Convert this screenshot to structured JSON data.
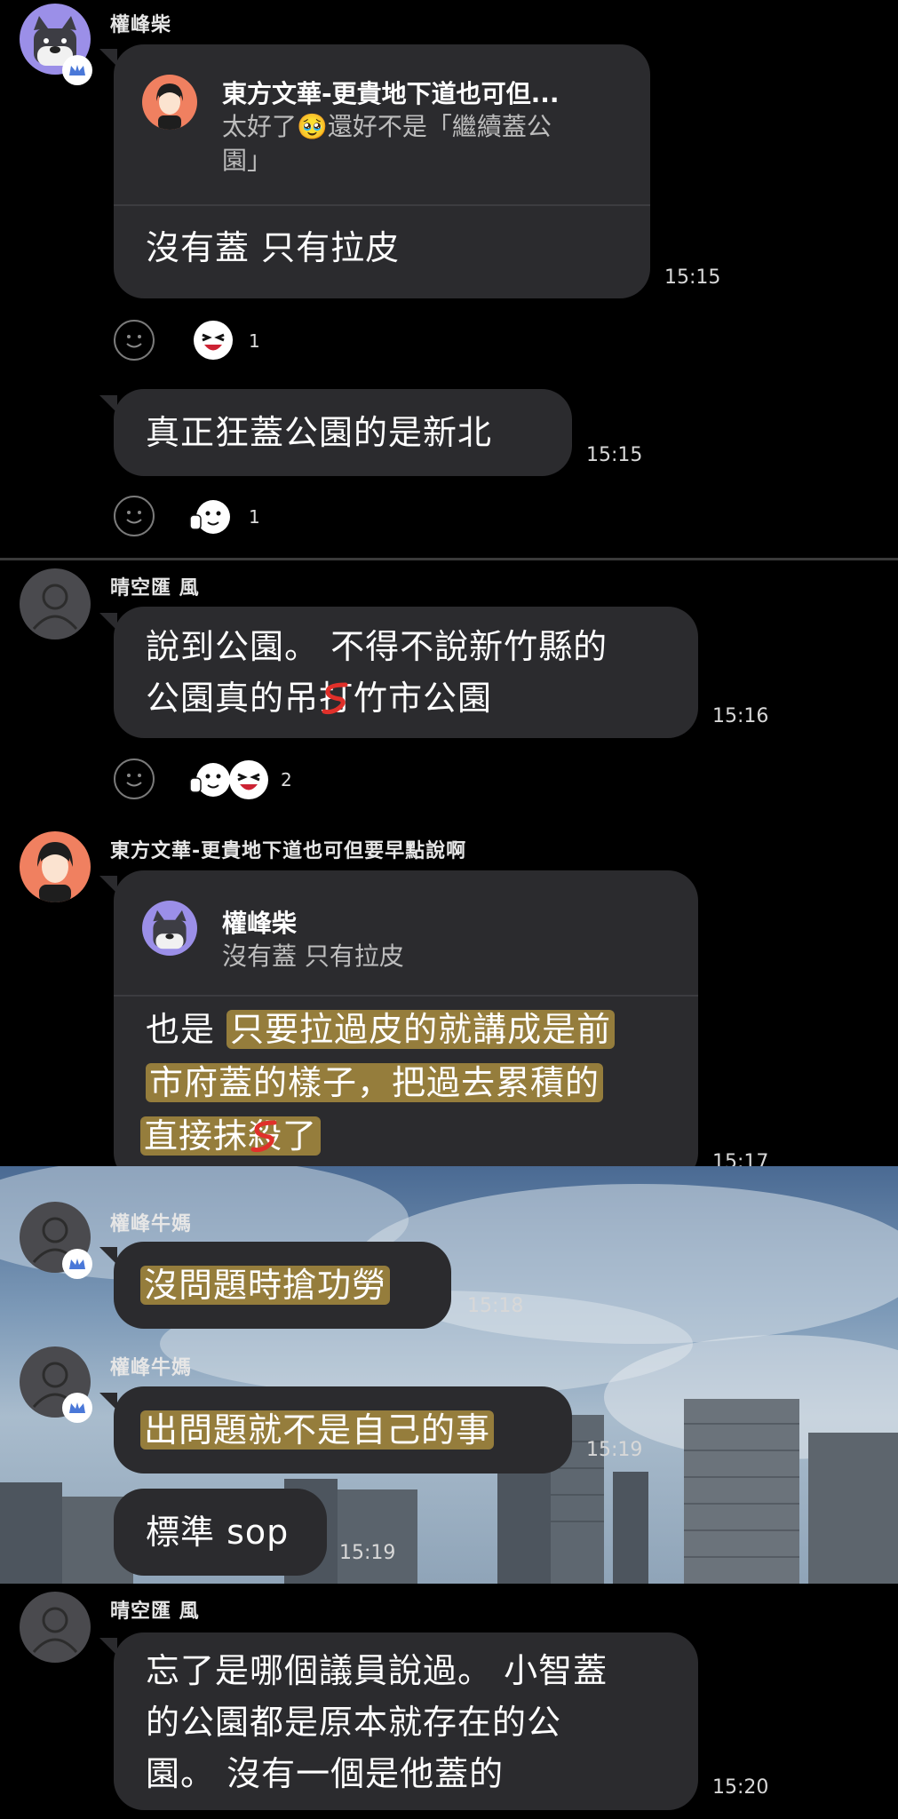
{
  "messages": [
    {
      "sender": "權峰柴",
      "quote": {
        "title": "東方文華-更貴地下道也可但...",
        "line1": "太好了🥹還好不是「繼續蓋公",
        "line2": "園」"
      },
      "text": "沒有蓋 只有拉皮",
      "time": "15:15",
      "reaction_count": "1"
    },
    {
      "text": "真正狂蓋公園的是新北",
      "time": "15:15",
      "reaction_count": "1"
    },
    {
      "sender": "晴空匯 風",
      "line1": "說到公園。 不得不說新竹縣的",
      "line2_a": "公園真的吊",
      "line2_struck": "打",
      "line2_b": "竹市公園",
      "time": "15:16",
      "reaction_count": "2"
    },
    {
      "sender": "東方文華-更貴地下道也可但要早點說啊",
      "quote": {
        "title": "權峰柴",
        "line1": "沒有蓋 只有拉皮"
      },
      "line1_a": "也是 ",
      "line1_hl": "只要拉過皮的就講成是前",
      "line2": "市府蓋的樣子，把過去累積的",
      "line3_a": "直接抹",
      "line3_struck": "殺",
      "line3_b": "了",
      "time": "15:17"
    },
    {
      "sender": "權峰牛媽",
      "text": "沒問題時搶功勞",
      "time": "15:18"
    },
    {
      "sender": "權峰牛媽",
      "text": "出問題就不是自己的事",
      "time": "15:19"
    },
    {
      "text": "標準 sop",
      "time": "15:19"
    },
    {
      "sender": "晴空匯 風",
      "line1": "忘了是哪個議員說過。 小智蓋",
      "line2": "的公園都是原本就存在的公",
      "line3": "園。 沒有一個是他蓋的",
      "time": "15:20"
    }
  ],
  "icons": {
    "avatar_dog": "dog-avatar-icon",
    "avatar_default": "default-user-avatar",
    "avatar_person": "person-avatar-icon",
    "crown": "crown-badge-icon",
    "emoji_add": "add-reaction-icon",
    "reaction_laugh": "laughing-face-icon",
    "reaction_thumb": "thumbs-up-face-icon"
  },
  "colors": {
    "background": "#000000",
    "bubble": "#2b2b2e",
    "highlight": "#d6b046",
    "accent_crown": "#4a78d8",
    "strike_red": "#e0302a"
  }
}
